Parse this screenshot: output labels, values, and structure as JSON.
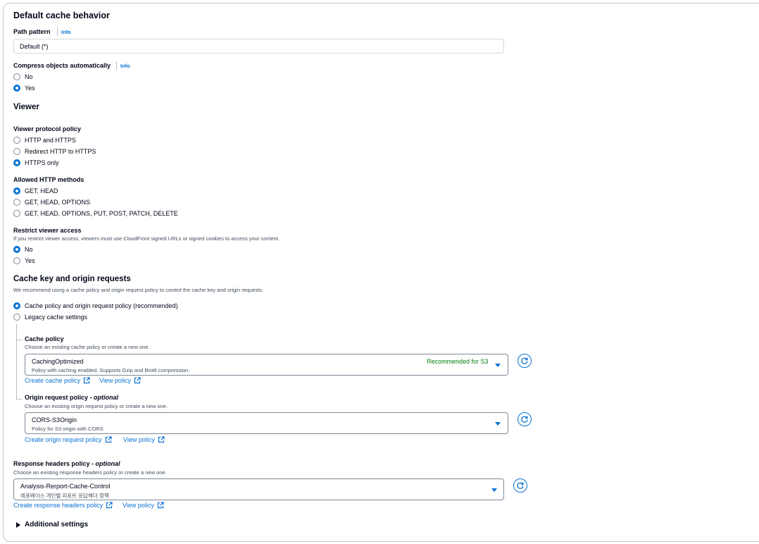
{
  "default_cache": {
    "title": "Default cache behavior",
    "path_pattern": {
      "label": "Path pattern",
      "info": "Info",
      "value": "Default (*)"
    },
    "compress": {
      "label": "Compress objects automatically",
      "info": "Info",
      "options": [
        "No",
        "Yes"
      ],
      "selected": "Yes"
    }
  },
  "viewer": {
    "title": "Viewer",
    "protocol": {
      "label": "Viewer protocol policy",
      "options": [
        "HTTP and HTTPS",
        "Redirect HTTP to HTTPS",
        "HTTPS only"
      ],
      "selected": "HTTPS only"
    },
    "methods": {
      "label": "Allowed HTTP methods",
      "options": [
        "GET, HEAD",
        "GET, HEAD, OPTIONS",
        "GET, HEAD, OPTIONS, PUT, POST, PATCH, DELETE"
      ],
      "selected": "GET, HEAD"
    },
    "restrict": {
      "label": "Restrict viewer access",
      "description": "If you restrict viewer access, viewers must use CloudFront signed URLs or signed cookies to access your content.",
      "options": [
        "No",
        "Yes"
      ],
      "selected": "No"
    }
  },
  "cache_key": {
    "title": "Cache key and origin requests",
    "description": "We recommend using a cache policy and origin request policy to control the cache key and origin requests.",
    "options": [
      "Cache policy and origin request policy (recommended)",
      "Legacy cache settings"
    ],
    "selected": "Cache policy and origin request policy (recommended)",
    "cache_policy": {
      "label": "Cache policy",
      "description": "Choose an existing cache policy or create a new one.",
      "selected_title": "CachingOptimized",
      "selected_desc": "Policy with caching enabled. Supports Gzip and Brotli compression.",
      "badge": "Recommended for S3",
      "create_link": "Create cache policy",
      "view_link": "View policy"
    },
    "origin_policy": {
      "label": "Origin request policy - ",
      "label_optional": "optional",
      "description": "Choose an existing origin request policy or create a new one.",
      "selected_title": "CORS-S3Origin",
      "selected_desc": "Policy for S3 origin with CORS",
      "create_link": "Create origin request policy",
      "view_link": "View policy"
    }
  },
  "response_headers": {
    "label": "Response headers policy - ",
    "label_optional": "optional",
    "description": "Choose an existing response headers policy or create a new one.",
    "selected_title": "Analysis-Rerport-Cache-Control",
    "selected_desc": "레포베이스 개인별 리포트 응답헤더 정책",
    "create_link": "Create response headers policy",
    "view_link": "View policy"
  },
  "additional_settings": {
    "label": "Additional settings"
  },
  "colors": {
    "link": "#0972d3",
    "badge": "#037f0c",
    "text": "#000716",
    "muted": "#414d5c"
  },
  "icons": [
    "external-link-icon",
    "refresh-icon",
    "caret-down-icon",
    "triangle-right-icon"
  ]
}
